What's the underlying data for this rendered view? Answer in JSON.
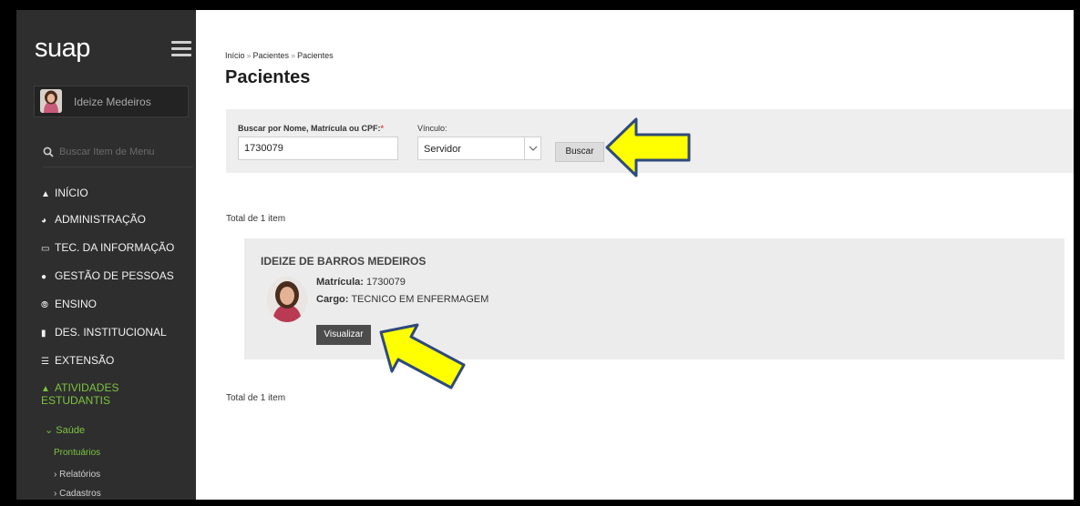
{
  "sidebar": {
    "logo": "suap",
    "user_name": "Ideize Medeiros",
    "search_placeholder": "Buscar Item de Menu",
    "menu": [
      {
        "label": "INÍCIO",
        "icon": "home-icon"
      },
      {
        "label": "ADMINISTRAÇÃO",
        "icon": "pie-chart-icon"
      },
      {
        "label": "TEC. DA INFORMAÇÃO",
        "icon": "monitor-icon"
      },
      {
        "label": "GESTÃO DE PESSOAS",
        "icon": "user-icon"
      },
      {
        "label": "ENSINO",
        "icon": "pencil-icon"
      },
      {
        "label": "DES. INSTITUCIONAL",
        "icon": "bar-chart-icon"
      },
      {
        "label": "EXTENSÃO",
        "icon": "list-icon"
      },
      {
        "label": "ATIVIDADES ESTUDANTIS",
        "icon": "graduation-cap-icon"
      }
    ],
    "submenu": {
      "saude": "Saúde",
      "prontuarios": "Prontuários",
      "relatorios": "Relatórios",
      "cadastros": "Cadastros"
    }
  },
  "breadcrumb": [
    "Início",
    "Pacientes",
    "Pacientes"
  ],
  "page_title": "Pacientes",
  "search": {
    "nome_label": "Buscar por Nome, Matrícula ou CPF:",
    "nome_required": "*",
    "nome_value": "1730079",
    "vinculo_label": "Vínculo:",
    "vinculo_value": "Servidor",
    "button": "Buscar"
  },
  "results": {
    "total_text": "Total de 1 item",
    "card": {
      "name": "IDEIZE DE BARROS MEDEIROS",
      "matricula_label": "Matrícula:",
      "matricula_value": "1730079",
      "cargo_label": "Cargo:",
      "cargo_value": "TECNICO EM ENFERMAGEM",
      "button": "Visualizar"
    }
  },
  "colors": {
    "sidebar_bg": "#2e2e2e",
    "active_green": "#7cc341",
    "arrow_fill": "#ffff00",
    "arrow_stroke": "#2f4a7a"
  }
}
